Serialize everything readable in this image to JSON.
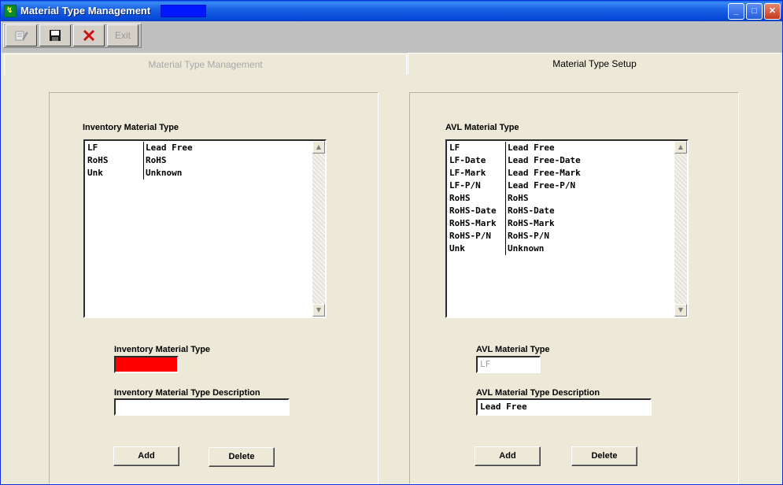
{
  "window": {
    "title": "Material Type Management",
    "app_icon": "app-icon",
    "controls": [
      "minimize-icon",
      "maximize-icon",
      "close-icon"
    ]
  },
  "toolbar": {
    "edit_icon": "edit-icon",
    "save_icon": "save-icon",
    "delete_icon": "x-icon",
    "exit_label": "Exit"
  },
  "tabs": [
    {
      "label": "Material Type Management",
      "active": false
    },
    {
      "label": "Material Type Setup",
      "active": true
    }
  ],
  "inventory": {
    "list_title": "Inventory Material Type",
    "rows": [
      [
        "LF",
        "Lead Free"
      ],
      [
        "RoHS",
        "RoHS"
      ],
      [
        "Unk",
        "Unknown"
      ]
    ],
    "type_label": "Inventory Material Type",
    "type_value": "",
    "type_field_color": "#ff0000",
    "desc_label": "Inventory Material Type Description",
    "desc_value": "",
    "add_label": "Add",
    "delete_label": "Delete"
  },
  "avl": {
    "list_title": "AVL Material Type",
    "rows": [
      [
        "LF",
        "Lead Free"
      ],
      [
        "LF-Date",
        "Lead Free-Date"
      ],
      [
        "LF-Mark",
        "Lead Free-Mark"
      ],
      [
        "LF-P/N",
        "Lead Free-P/N"
      ],
      [
        "RoHS",
        "RoHS"
      ],
      [
        "RoHS-Date",
        "RoHS-Date"
      ],
      [
        "RoHS-Mark",
        "RoHS-Mark"
      ],
      [
        "RoHS-P/N",
        "RoHS-P/N"
      ],
      [
        "Unk",
        "Unknown"
      ]
    ],
    "type_label": "AVL Material Type",
    "type_value": "LF",
    "desc_label": "AVL Material Type Description",
    "desc_value": "Lead Free",
    "add_label": "Add",
    "delete_label": "Delete"
  }
}
